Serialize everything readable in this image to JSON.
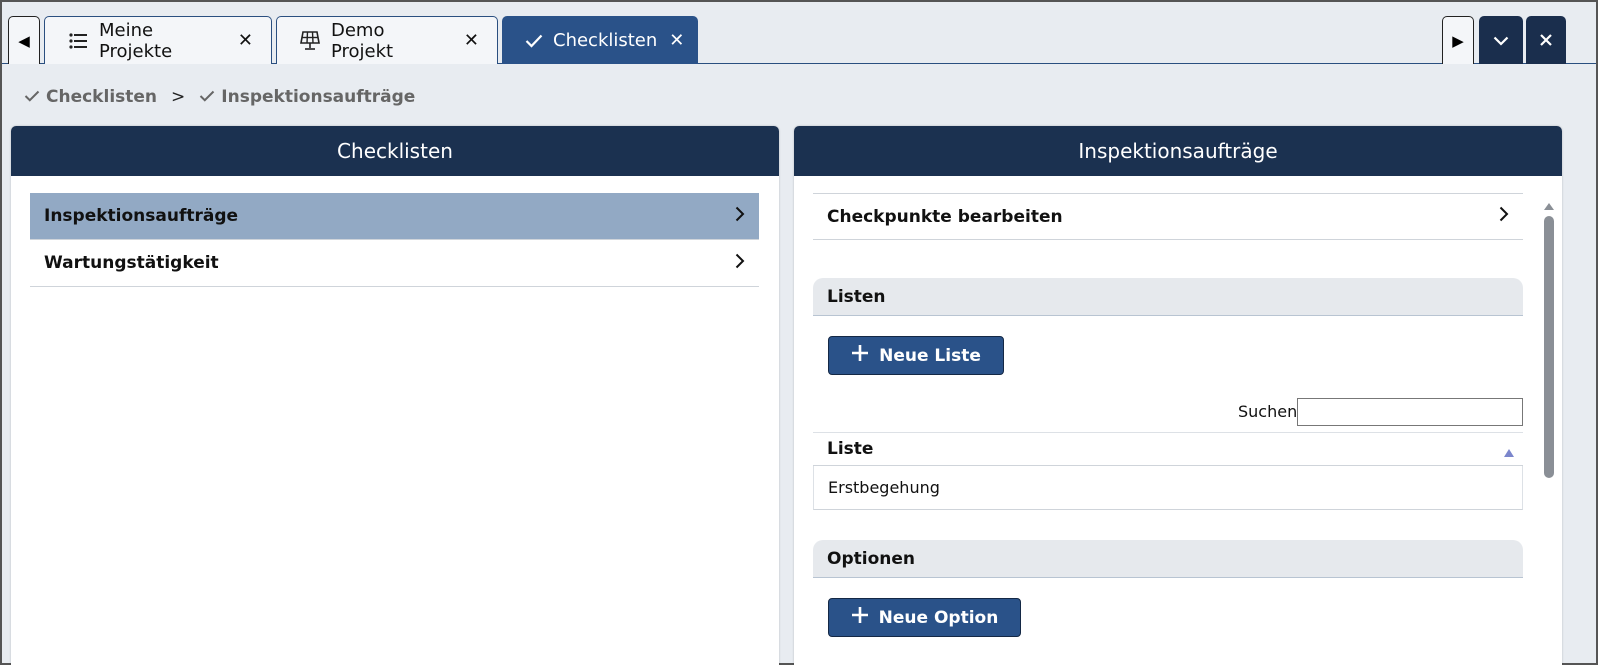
{
  "tabs": [
    {
      "label": "Meine Projekte",
      "icon": "list-icon",
      "close": "✕"
    },
    {
      "label": "Demo Projekt",
      "icon": "solar-panel-icon",
      "close": "✕"
    },
    {
      "label": "Checklisten",
      "icon": "check-icon",
      "close": "✕",
      "active": true
    }
  ],
  "nav": {
    "prev": "◀",
    "next": "▶"
  },
  "breadcrumb": {
    "first": "Checklisten",
    "separator": ">",
    "second": "Inspektionsaufträge"
  },
  "left_panel": {
    "title": "Checklisten",
    "items": [
      {
        "label": "Inspektionsaufträge",
        "selected": true
      },
      {
        "label": "Wartungstätigkeit"
      }
    ]
  },
  "right_panel": {
    "title": "Inspektionsaufträge",
    "edit_row": "Checkpunkte bearbeiten",
    "listen": {
      "heading": "Listen",
      "new_button": "Neue Liste",
      "search_label": "Suchen",
      "search_value": "",
      "column": "Liste",
      "rows": [
        "Erstbegehung"
      ]
    },
    "optionen": {
      "heading": "Optionen",
      "new_button": "Neue Option"
    }
  },
  "colors": {
    "header_dark": "#1b3150",
    "accent": "#2a5289",
    "selected_row": "#92a9c4"
  }
}
